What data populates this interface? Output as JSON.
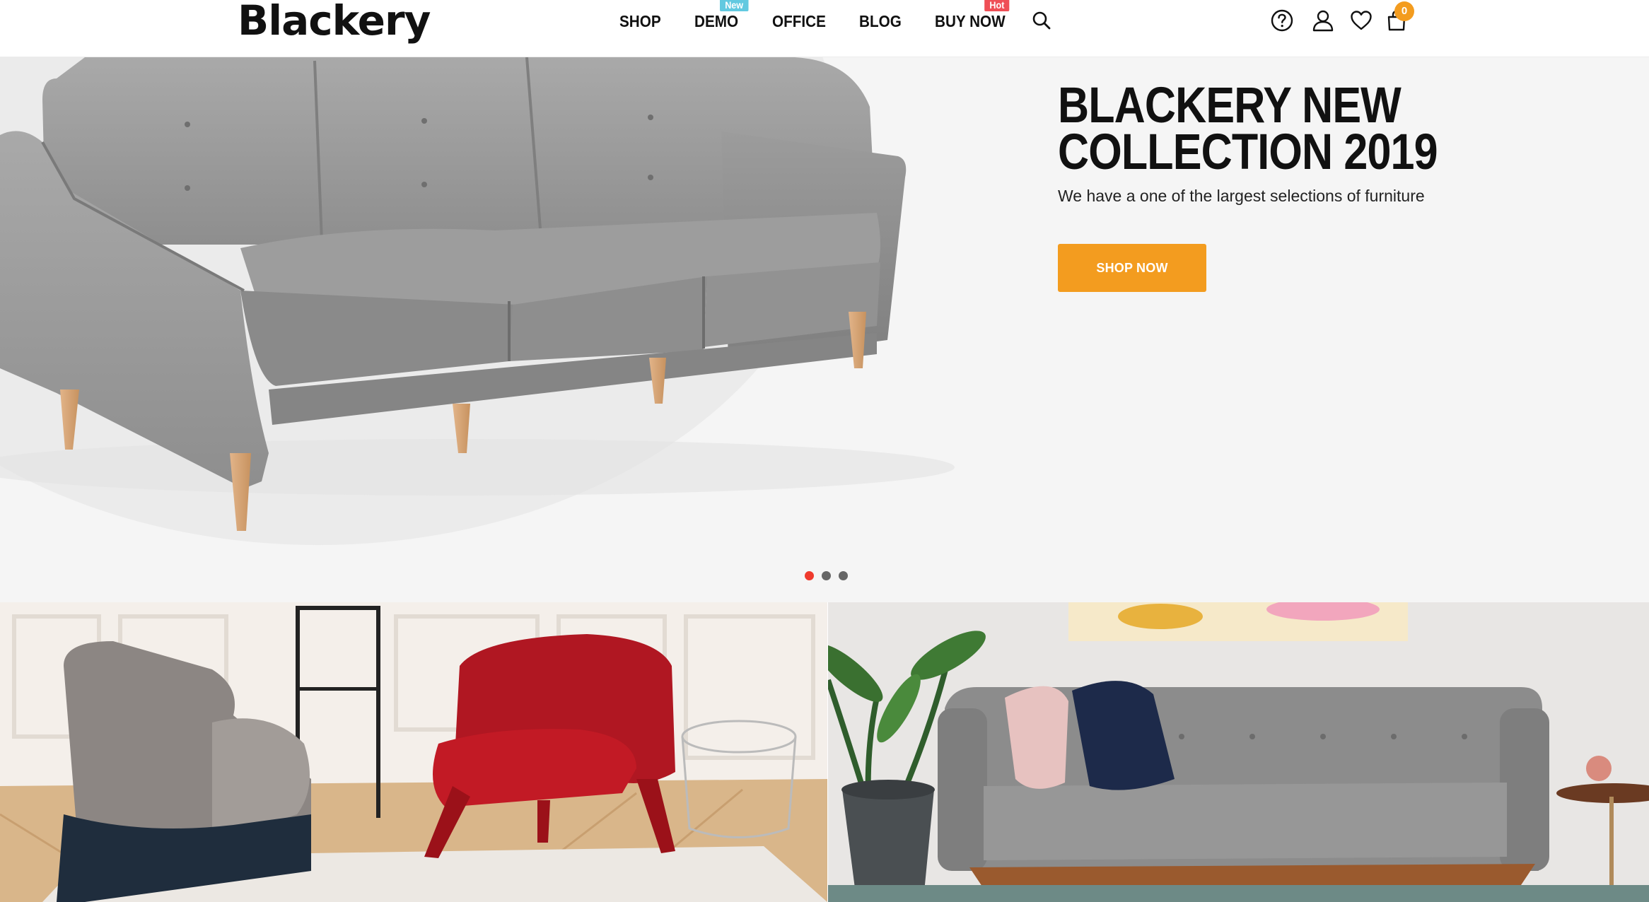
{
  "brand": {
    "logo_text": "Blackery"
  },
  "nav": {
    "items": [
      {
        "label": "SHOP"
      },
      {
        "label": "DEMO",
        "badge": "New"
      },
      {
        "label": "OFFICE"
      },
      {
        "label": "BLOG"
      },
      {
        "label": "BUY NOW",
        "badge": "Hot"
      }
    ],
    "search_icon": "search-icon"
  },
  "header_actions": {
    "icons": [
      "help-circle-icon",
      "user-icon",
      "heart-icon",
      "shopping-bag-icon"
    ],
    "cart_count": "0"
  },
  "hero": {
    "title_line1": "BLACKERY NEW",
    "title_line2": "COLLECTION 2019",
    "subtitle": "We have a one of the largest selections of furniture",
    "cta_label": "SHOP NOW",
    "slide_count": 3,
    "active_slide": 1
  },
  "banners": [
    {
      "image": "armchairs-room-photo"
    },
    {
      "image": "grey-sofa-living-room-photo"
    }
  ],
  "colors": {
    "accent": "#f39c1f",
    "badge_new": "#62c9e0",
    "badge_hot": "#ef4f56",
    "dot_active": "#ef3a2d",
    "hero_bg": "#f5f5f5"
  }
}
